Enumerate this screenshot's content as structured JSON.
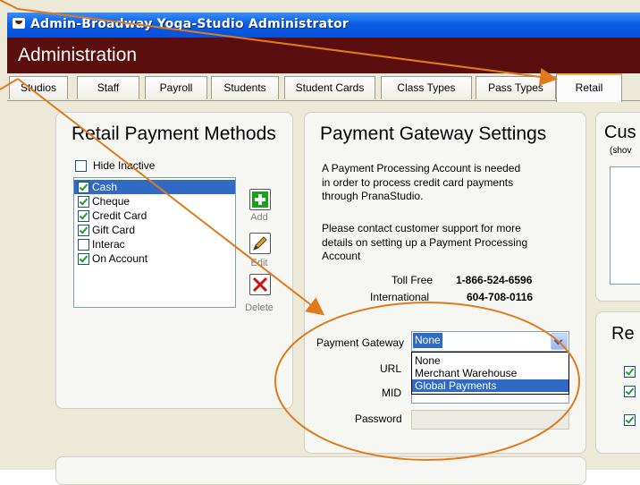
{
  "window": {
    "title": "Admin-Broadway Yoga-Studio Administrator"
  },
  "header": {
    "title": "Administration"
  },
  "tabs": [
    {
      "label": "Studios"
    },
    {
      "label": "Staff"
    },
    {
      "label": "Payroll"
    },
    {
      "label": "Students"
    },
    {
      "label": "Student Cards"
    },
    {
      "label": "Class Types"
    },
    {
      "label": "Pass Types"
    },
    {
      "label": "Retail",
      "active": true
    }
  ],
  "retail_methods": {
    "title": "Retail Payment Methods",
    "hide_inactive_label": "Hide Inactive",
    "hide_inactive_checked": false,
    "items": [
      {
        "label": "Cash",
        "checked": true,
        "selected": true
      },
      {
        "label": "Cheque",
        "checked": true
      },
      {
        "label": "Credit Card",
        "checked": true
      },
      {
        "label": "Gift Card",
        "checked": true
      },
      {
        "label": "Interac",
        "checked": false
      },
      {
        "label": "On Account",
        "checked": true
      }
    ],
    "add_label": "Add",
    "edit_label": "Edit",
    "delete_label": "Delete"
  },
  "gateway": {
    "title": "Payment Gateway Settings",
    "desc_lines": [
      "A Payment Processing Account is needed",
      "in order to process credit card payments",
      "through PranaStudio."
    ],
    "contact_lines": [
      "Please contact customer support for more",
      "details on setting up a Payment Processing",
      "Account"
    ],
    "toll_free_label": "Toll Free",
    "toll_free_number": "1-866-524-6596",
    "international_label": "International",
    "international_number": "604-708-0116",
    "payment_gateway_label": "Payment Gateway",
    "selected_gateway": "None",
    "options": [
      "None",
      "Merchant Warehouse",
      "Global Payments"
    ],
    "highlighted_option": "Global Payments",
    "url_label": "URL",
    "mid_label": "MID",
    "password_label": "Password"
  },
  "right": {
    "cus_title": "Cus",
    "cus_sub": "(shov",
    "re_title": "Re"
  },
  "colors": {
    "titlebar": "#0a5fe6",
    "header": "#5a0e0e",
    "annotation": "#e07a1a",
    "selection": "#316ac5"
  }
}
